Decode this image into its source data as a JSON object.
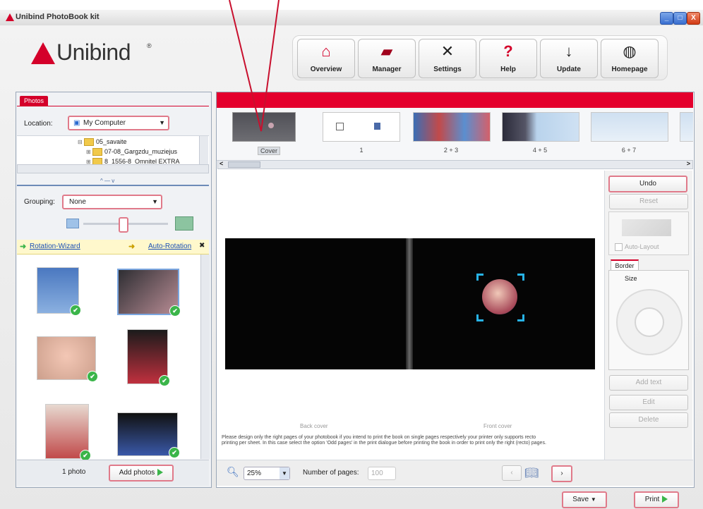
{
  "window": {
    "title": "Unibind PhotoBook kit",
    "min_label": "_",
    "max_label": "□",
    "close_label": "X"
  },
  "brand": {
    "logo_text": "Unibind",
    "reg_mark": "®",
    "accent": "#e4002d"
  },
  "toolbar": [
    {
      "label": "Overview",
      "icon": "home-icon",
      "glyph": "⌂"
    },
    {
      "label": "Manager",
      "icon": "folder-icon",
      "glyph": "▰"
    },
    {
      "label": "Settings",
      "icon": "wrench-screwdriver-icon",
      "glyph": "✕"
    },
    {
      "label": "Help",
      "icon": "help-person-icon",
      "glyph": "?"
    },
    {
      "label": "Update",
      "icon": "download-icon",
      "glyph": "↓"
    },
    {
      "label": "Homepage",
      "icon": "globe-icon",
      "glyph": "◍"
    }
  ],
  "left": {
    "tab_label": "Photos",
    "location_label": "Location:",
    "location_value": "My Computer",
    "tree": [
      "05_savaite",
      "07-08_Gargzdu_muziejus",
      "8_1556-8_Omnitel EXTRA"
    ],
    "grouping_label": "Grouping:",
    "grouping_value": "None",
    "rotation_wizard": "Rotation-Wizard",
    "auto_rotation": "Auto-Rotation",
    "close_glyph": "✖",
    "photo_count": "1 photo",
    "add_photos": "Add photos"
  },
  "pages": {
    "labels": [
      "Cover",
      "1",
      "2 + 3",
      "4 + 5",
      "6 + 7"
    ]
  },
  "canvas": {
    "back_cover": "Back cover",
    "front_cover": "Front cover",
    "hint": "Please design only the right pages of your photobook if you intend to print the book on single pages respectively your printer only supports recto printing per sheet. In this case select the option 'Odd pages' in the print dialogue before printing the book in order to print only the right (recto) pages."
  },
  "side": {
    "undo": "Undo",
    "reset": "Reset",
    "auto_layout": "Auto-Layout",
    "border_tab": "Border",
    "size_label": "Size",
    "add_text": "Add text",
    "edit": "Edit",
    "delete": "Delete"
  },
  "bottom": {
    "zoom_value": "25%",
    "pages_label": "Number of pages:",
    "pages_value": "100",
    "save": "Save",
    "print": "Print"
  }
}
